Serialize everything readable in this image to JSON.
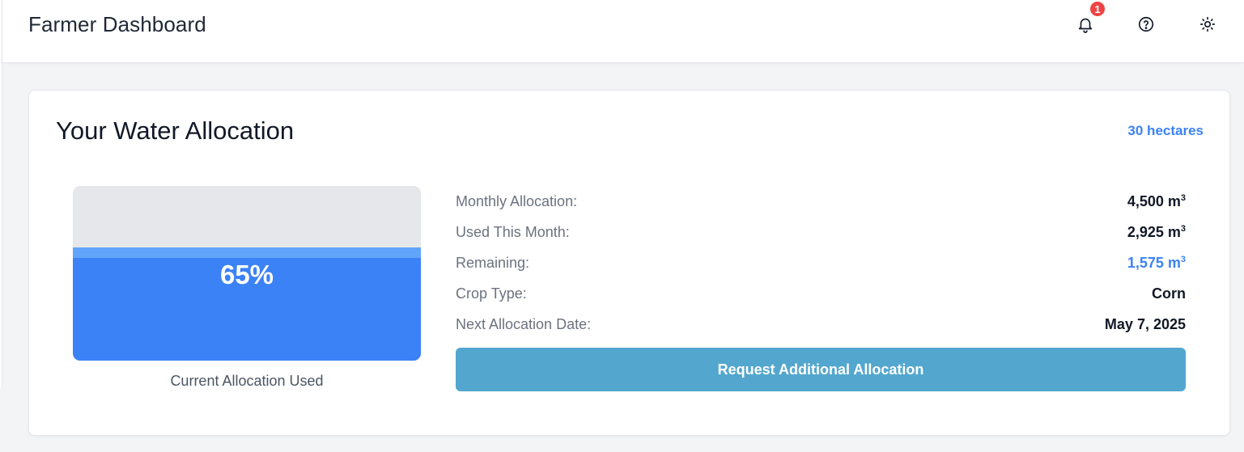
{
  "header": {
    "title": "Farmer Dashboard",
    "notification_count": "1",
    "icons": [
      "bell-icon",
      "help-circle-icon",
      "sun-icon"
    ]
  },
  "allocation": {
    "title": "Your Water Allocation",
    "area": "30 hectares",
    "used_percent": 65,
    "used_percent_label": "65%",
    "gauge_caption": "Current Allocation Used",
    "stats": [
      {
        "label": "Monthly Allocation:",
        "value": "4,500 m",
        "unit_sup": "3",
        "accent": false
      },
      {
        "label": "Used This Month:",
        "value": "2,925 m",
        "unit_sup": "3",
        "accent": false
      },
      {
        "label": "Remaining:",
        "value": "1,575 m",
        "unit_sup": "3",
        "accent": true
      },
      {
        "label": "Crop Type:",
        "value": "Corn",
        "unit_sup": "",
        "accent": false
      },
      {
        "label": "Next Allocation Date:",
        "value": "May 7, 2025",
        "unit_sup": "",
        "accent": false
      }
    ],
    "request_button": "Request Additional Allocation"
  },
  "colors": {
    "accent": "#3b82f6",
    "gauge_fill": "#3b82f6",
    "gauge_empty": "#e5e7eb",
    "button": "#53a7ce",
    "badge": "#ef4444"
  }
}
